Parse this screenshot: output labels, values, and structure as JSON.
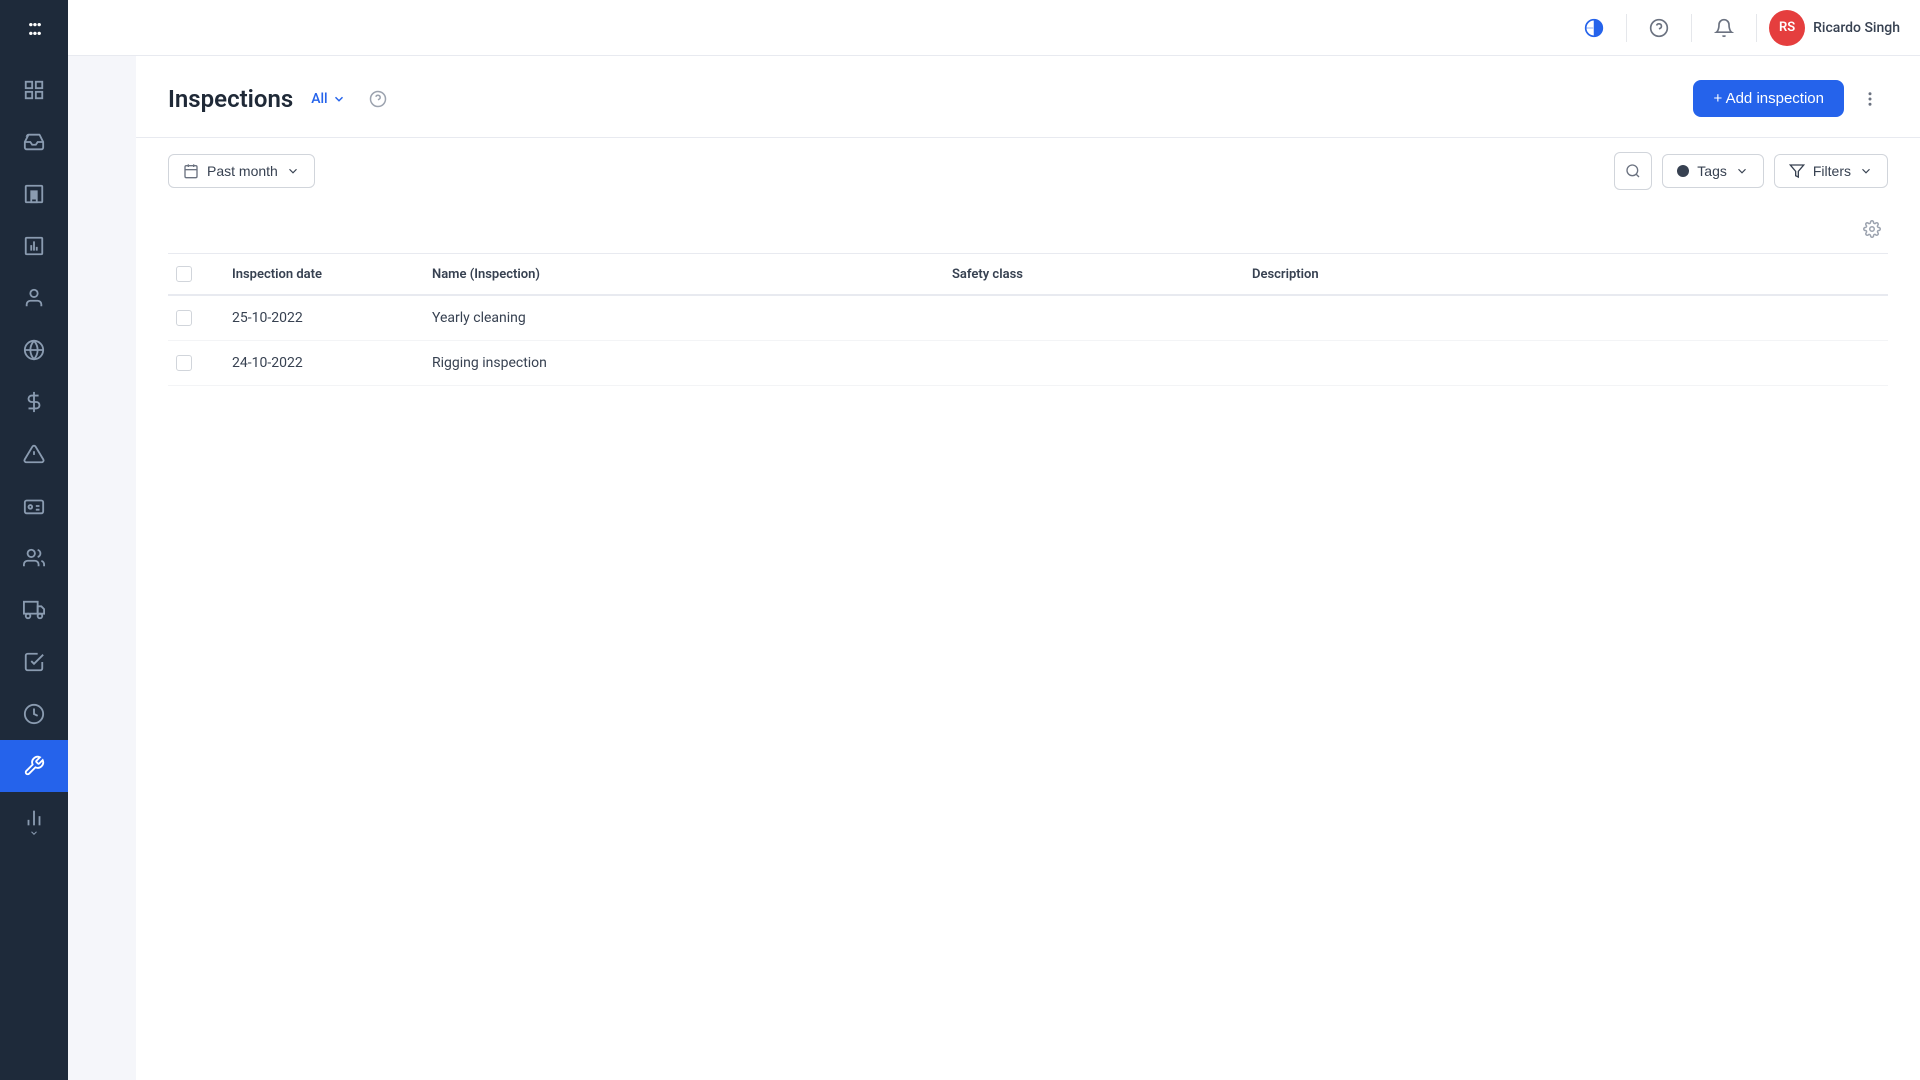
{
  "sidebar": {
    "logo": ":::",
    "items": [
      {
        "name": "dashboard",
        "icon": "grid",
        "active": false
      },
      {
        "name": "inbox",
        "icon": "inbox",
        "active": false
      },
      {
        "name": "building",
        "icon": "building",
        "active": false
      },
      {
        "name": "chart",
        "icon": "chart",
        "active": false
      },
      {
        "name": "person",
        "icon": "person",
        "active": false
      },
      {
        "name": "globe",
        "icon": "globe",
        "active": false
      },
      {
        "name": "dollar",
        "icon": "dollar",
        "active": false
      },
      {
        "name": "warning",
        "icon": "warning",
        "active": false
      },
      {
        "name": "id-card",
        "icon": "id-card",
        "active": false
      },
      {
        "name": "people",
        "icon": "people",
        "active": false
      },
      {
        "name": "truck",
        "icon": "truck",
        "active": false
      },
      {
        "name": "checklist",
        "icon": "checklist",
        "active": false
      },
      {
        "name": "clock",
        "icon": "clock",
        "active": false
      },
      {
        "name": "wrench",
        "icon": "wrench",
        "active": true
      },
      {
        "name": "bar-chart",
        "icon": "bar-chart",
        "active": false
      }
    ]
  },
  "topbar": {
    "theme_icon": "◑",
    "help_icon": "?",
    "bell_icon": "🔔",
    "avatar_initials": "RS",
    "username": "Ricardo Singh"
  },
  "page": {
    "title": "Inspections",
    "filter_label": "All",
    "add_button_label": "+ Add inspection",
    "date_filter_label": "Past month",
    "tags_label": "Tags",
    "filters_label": "Filters"
  },
  "table": {
    "columns": [
      {
        "id": "checkbox",
        "label": ""
      },
      {
        "id": "date",
        "label": "Inspection date"
      },
      {
        "id": "name",
        "label": "Name (Inspection)"
      },
      {
        "id": "safety",
        "label": "Safety class"
      },
      {
        "id": "description",
        "label": "Description"
      }
    ],
    "rows": [
      {
        "date": "25-10-2022",
        "name": "Yearly cleaning",
        "safety": "",
        "description": ""
      },
      {
        "date": "24-10-2022",
        "name": "Rigging inspection",
        "safety": "",
        "description": ""
      }
    ]
  }
}
